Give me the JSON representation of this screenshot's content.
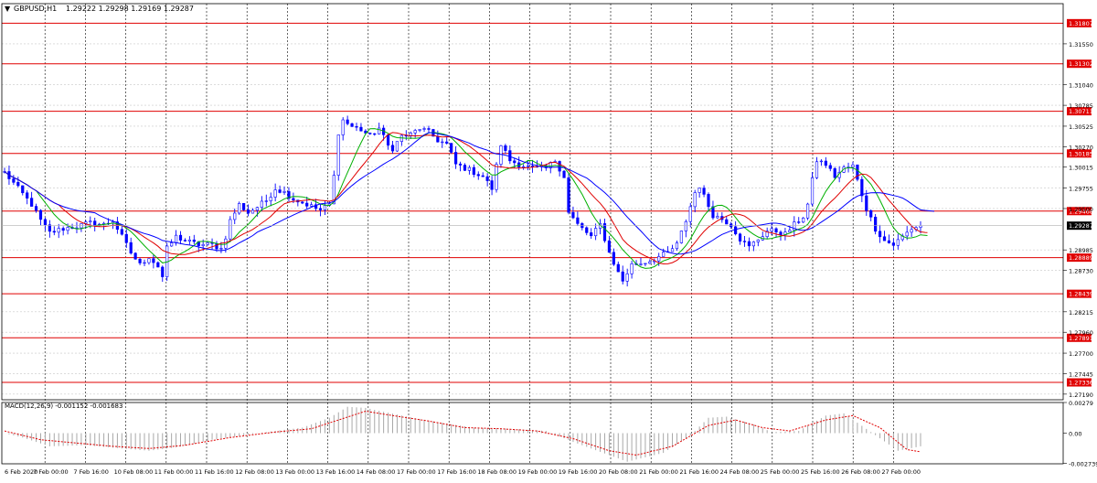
{
  "window": {
    "symbol_label": "GBPUSD,H1",
    "ohlc_label": "1.29222 1.29298 1.29169 1.29287"
  },
  "colors": {
    "background": "#ffffff",
    "grid": "#c8c8c8",
    "candle": "#0000ff",
    "level_line": "#e00000",
    "level_label_bg": "#e00000",
    "level_label_text": "#ffffff",
    "ma_fast": "#00b000",
    "ma_mid": "#e00000",
    "ma_slow": "#0000ff",
    "macd_hist": "#a8a8a8",
    "macd_signal": "#e00000",
    "current_price_bg": "#000000"
  },
  "chart_data": [
    {
      "type": "candlestick",
      "title": "GBPUSD,H1",
      "x_tick_labels": [
        "6 Feb 2020",
        "7 Feb 00:00",
        "7 Feb 16:00",
        "10 Feb 08:00",
        "11 Feb 00:00",
        "11 Feb 16:00",
        "12 Feb 08:00",
        "13 Feb 00:00",
        "13 Feb 16:00",
        "14 Feb 08:00",
        "17 Feb 00:00",
        "17 Feb 16:00",
        "18 Feb 08:00",
        "19 Feb 00:00",
        "19 Feb 16:00",
        "20 Feb 08:00",
        "21 Feb 00:00",
        "21 Feb 16:00",
        "24 Feb 08:00",
        "25 Feb 00:00",
        "25 Feb 16:00",
        "26 Feb 08:00",
        "27 Feb 00:00"
      ],
      "y_tick_labels": [
        "1.31550",
        "1.31040",
        "1.30785",
        "1.30525",
        "1.30270",
        "1.30015",
        "1.29755",
        "1.29500",
        "1.28985",
        "1.28730",
        "1.28215",
        "1.27960",
        "1.27700",
        "1.27445",
        "1.27190"
      ],
      "ylim": [
        1.2712,
        1.3205
      ],
      "horizontal_levels": [
        1.31807,
        1.31302,
        1.30711,
        1.30185,
        1.29468,
        1.28889,
        1.28439,
        1.27891,
        1.27336
      ],
      "current_price": "1.29287",
      "indicators": [
        "moving average fast (green)",
        "moving average medium (red)",
        "moving average slow (blue)"
      ],
      "close_anchors": [
        [
          0,
          1.2995
        ],
        [
          3,
          1.2975
        ],
        [
          6,
          1.2955
        ],
        [
          8,
          1.2935
        ],
        [
          10,
          1.292
        ],
        [
          13,
          1.2925
        ],
        [
          16,
          1.2928
        ],
        [
          19,
          1.2932
        ],
        [
          22,
          1.293
        ],
        [
          24,
          1.2935
        ],
        [
          26,
          1.2915
        ],
        [
          28,
          1.2895
        ],
        [
          30,
          1.288
        ],
        [
          32,
          1.289
        ],
        [
          34,
          1.2878
        ],
        [
          35,
          1.2865
        ],
        [
          36,
          1.29
        ],
        [
          38,
          1.2915
        ],
        [
          40,
          1.291
        ],
        [
          43,
          1.2905
        ],
        [
          46,
          1.2905
        ],
        [
          48,
          1.29
        ],
        [
          49,
          1.2915
        ],
        [
          50,
          1.2935
        ],
        [
          52,
          1.2955
        ],
        [
          54,
          1.2945
        ],
        [
          56,
          1.2952
        ],
        [
          58,
          1.296
        ],
        [
          60,
          1.2975
        ],
        [
          62,
          1.297
        ],
        [
          64,
          1.2962
        ],
        [
          67,
          1.2955
        ],
        [
          70,
          1.2948
        ],
        [
          72,
          1.2955
        ],
        [
          73,
          1.299
        ],
        [
          74,
          1.3045
        ],
        [
          75,
          1.306
        ],
        [
          77,
          1.3052
        ],
        [
          79,
          1.3048
        ],
        [
          81,
          1.304
        ],
        [
          83,
          1.305
        ],
        [
          85,
          1.3028
        ],
        [
          86,
          1.3025
        ],
        [
          88,
          1.304
        ],
        [
          90,
          1.3042
        ],
        [
          92,
          1.305
        ],
        [
          94,
          1.3045
        ],
        [
          96,
          1.3035
        ],
        [
          98,
          1.303
        ],
        [
          100,
          1.3005
        ],
        [
          103,
          1.2998
        ],
        [
          106,
          1.299
        ],
        [
          108,
          1.2975
        ],
        [
          110,
          1.303
        ],
        [
          112,
          1.301
        ],
        [
          114,
          1.3005
        ],
        [
          117,
          1.3
        ],
        [
          120,
          1.3
        ],
        [
          122,
          1.301
        ],
        [
          124,
          1.299
        ],
        [
          125,
          1.2945
        ],
        [
          127,
          1.293
        ],
        [
          130,
          1.2915
        ],
        [
          132,
          1.293
        ],
        [
          134,
          1.2895
        ],
        [
          136,
          1.287
        ],
        [
          137,
          1.286
        ],
        [
          139,
          1.288
        ],
        [
          141,
          1.2882
        ],
        [
          143,
          1.2885
        ],
        [
          145,
          1.289
        ],
        [
          147,
          1.2895
        ],
        [
          149,
          1.2905
        ],
        [
          151,
          1.2935
        ],
        [
          153,
          1.297
        ],
        [
          154,
          1.2978
        ],
        [
          155,
          1.2965
        ],
        [
          157,
          1.2942
        ],
        [
          159,
          1.2937
        ],
        [
          161,
          1.293
        ],
        [
          163,
          1.2912
        ],
        [
          165,
          1.2902
        ],
        [
          167,
          1.2912
        ],
        [
          169,
          1.2922
        ],
        [
          171,
          1.2922
        ],
        [
          173,
          1.2918
        ],
        [
          175,
          1.293
        ],
        [
          177,
          1.294
        ],
        [
          178,
          1.2955
        ],
        [
          179,
          1.2985
        ],
        [
          180,
          1.301
        ],
        [
          182,
          1.3005
        ],
        [
          184,
          1.299
        ],
        [
          186,
          1.3
        ],
        [
          188,
          1.3003
        ],
        [
          189,
          1.2985
        ],
        [
          191,
          1.295
        ],
        [
          193,
          1.2925
        ],
        [
          195,
          1.291
        ],
        [
          197,
          1.2905
        ],
        [
          199,
          1.2915
        ],
        [
          201,
          1.2925
        ],
        [
          203,
          1.2929
        ]
      ],
      "macd": {
        "label": "MACD(12,26,9) -0.001152 -0.001683",
        "ylim": [
          -0.00279,
          0.00279
        ],
        "y_tick_labels": [
          "0.00279",
          "0.00",
          "-0.002739"
        ],
        "value_anchors": [
          [
            0,
            0.0
          ],
          [
            4,
            -0.0004
          ],
          [
            10,
            -0.0012
          ],
          [
            18,
            -0.0011
          ],
          [
            26,
            -0.0014
          ],
          [
            32,
            -0.0016
          ],
          [
            38,
            -0.0013
          ],
          [
            46,
            -0.0006
          ],
          [
            58,
            0.0001
          ],
          [
            66,
            0.0005
          ],
          [
            72,
            0.0014
          ],
          [
            76,
            0.0024
          ],
          [
            80,
            0.0023
          ],
          [
            88,
            0.0016
          ],
          [
            96,
            0.001
          ],
          [
            104,
            0.0005
          ],
          [
            112,
            0.0004
          ],
          [
            120,
            0.0002
          ],
          [
            126,
            -0.0008
          ],
          [
            132,
            -0.0017
          ],
          [
            138,
            -0.0026
          ],
          [
            146,
            -0.0018
          ],
          [
            152,
            -0.0002
          ],
          [
            156,
            0.0014
          ],
          [
            160,
            0.0015
          ],
          [
            166,
            0.0008
          ],
          [
            170,
            0.0001
          ],
          [
            176,
            0.0002
          ],
          [
            182,
            0.0016
          ],
          [
            186,
            0.0018
          ],
          [
            192,
            0.0001
          ],
          [
            198,
            -0.0016
          ],
          [
            203,
            -0.0012
          ]
        ],
        "signal_anchors": [
          [
            0,
            0.0002
          ],
          [
            8,
            -0.0006
          ],
          [
            16,
            -0.0009
          ],
          [
            24,
            -0.0012
          ],
          [
            32,
            -0.0014
          ],
          [
            40,
            -0.0011
          ],
          [
            50,
            -0.0004
          ],
          [
            60,
            0.0001
          ],
          [
            68,
            0.0004
          ],
          [
            74,
            0.0012
          ],
          [
            80,
            0.002
          ],
          [
            86,
            0.0016
          ],
          [
            94,
            0.0011
          ],
          [
            102,
            0.0005
          ],
          [
            110,
            0.0004
          ],
          [
            118,
            0.0002
          ],
          [
            126,
            -0.0005
          ],
          [
            134,
            -0.0016
          ],
          [
            140,
            -0.002
          ],
          [
            148,
            -0.0012
          ],
          [
            156,
            0.0007
          ],
          [
            162,
            0.0012
          ],
          [
            168,
            0.0005
          ],
          [
            174,
            0.0002
          ],
          [
            182,
            0.0012
          ],
          [
            188,
            0.0016
          ],
          [
            194,
            0.0005
          ],
          [
            200,
            -0.0015
          ],
          [
            203,
            -0.0017
          ]
        ]
      }
    }
  ]
}
